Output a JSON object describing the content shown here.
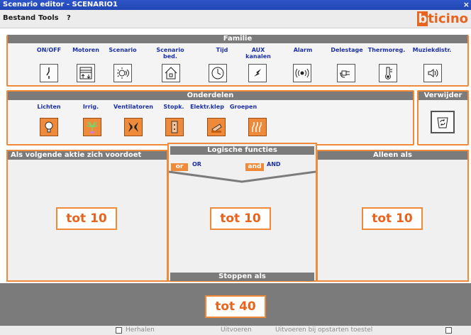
{
  "window": {
    "title": "Scenario editor - SCENARIO1",
    "close_glyph": "×"
  },
  "menu": {
    "items": [
      "Bestand",
      "Tools",
      "?"
    ],
    "brand": [
      "b",
      "ticino"
    ]
  },
  "familie": {
    "title": "Familie",
    "items": [
      {
        "label": "ON/OFF",
        "icon": "switch-icon"
      },
      {
        "label": "Motoren",
        "icon": "motor-icon"
      },
      {
        "label": "Scenario",
        "icon": "scenario-icon"
      },
      {
        "label": "Scenario bed.",
        "icon": "scenario-control-icon"
      },
      {
        "label": "Tijd",
        "icon": "clock-icon"
      },
      {
        "label": "AUX kanalen",
        "icon": "lightning-icon"
      },
      {
        "label": "Alarm",
        "icon": "alarm-icon"
      },
      {
        "label": "Delestage",
        "icon": "plug-icon"
      },
      {
        "label": "Thermoreg.",
        "icon": "thermometer-icon"
      },
      {
        "label": "Muziekdistr.",
        "icon": "speaker-icon"
      }
    ]
  },
  "onderdelen": {
    "title": "Onderdelen",
    "items": [
      {
        "label": "Lichten",
        "icon": "lightbulb-icon"
      },
      {
        "label": "Irrig.",
        "icon": "sprinkler-icon"
      },
      {
        "label": "Ventilatoren",
        "icon": "fan-icon"
      },
      {
        "label": "Stopk.",
        "icon": "socket-icon"
      },
      {
        "label": "Elektr.klep",
        "icon": "valve-icon"
      },
      {
        "label": "Groepen",
        "icon": "groups-icon"
      }
    ]
  },
  "verwijder": {
    "title": "Verwijder",
    "icon": "recycle-icon"
  },
  "columns": {
    "left": {
      "title": "Als volgende aktie zich voordoet",
      "count": "tot 10"
    },
    "middle": {
      "title": "Logische functies",
      "or_tag": "or",
      "or_label": "OR",
      "and_tag": "and",
      "and_label": "AND",
      "count": "tot 10",
      "footer": "Stoppen als"
    },
    "right": {
      "title": "Alleen als",
      "count": "tot 10"
    }
  },
  "bottom": {
    "count": "tot 40",
    "status": {
      "herhalen": "Herhalen",
      "uitvoeren": "Uitvoeren",
      "uitvoeren_bij": "Uitvoeren bij opstarten toestel"
    }
  },
  "colors": {
    "accent": "#ef8a3a",
    "header_gray": "#7b7b7b",
    "title_blue": "#2146b4",
    "label_blue": "#1b2fa8"
  }
}
